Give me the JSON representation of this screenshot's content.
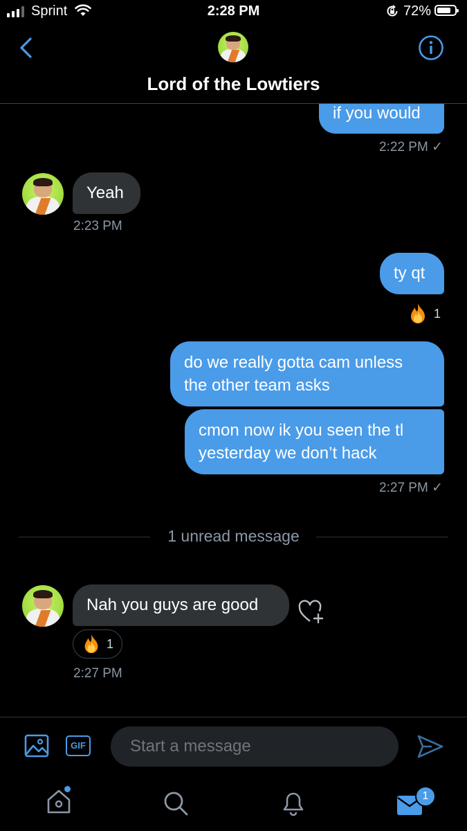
{
  "status_bar": {
    "carrier": "Sprint",
    "time": "2:28 PM",
    "battery": "72%"
  },
  "header": {
    "title": "Lord of the Lowtiers"
  },
  "messages": {
    "m1_text": "if you would",
    "m1_time": "2:22 PM ✓",
    "m2_text": "Yeah",
    "m2_time": "2:23 PM",
    "m3_text": "ty qt",
    "m3_reaction_count": "1",
    "m4_line1": "do we really gotta cam unless",
    "m4_line2": "the other team asks",
    "m5_line1": "cmon now ik you seen the tl",
    "m5_line2": "yesterday we don’t hack",
    "m5_time": "2:27 PM ✓",
    "unread_divider": "1 unread message",
    "m6_text": "Nah you guys are good",
    "m6_reaction_count": "1",
    "m6_time": "2:27 PM"
  },
  "composer": {
    "placeholder": "Start a message",
    "gif_label": "GIF"
  },
  "tab_bar": {
    "messages_badge": "1"
  },
  "colors": {
    "accent": "#4a9be8",
    "incoming_bubble": "#2f3336",
    "background": "#000000"
  },
  "icons": [
    "back-icon",
    "info-icon",
    "heart-plus-icon",
    "image-icon",
    "send-icon",
    "home-icon",
    "search-icon",
    "bell-icon",
    "mail-icon",
    "fire-emoji"
  ]
}
